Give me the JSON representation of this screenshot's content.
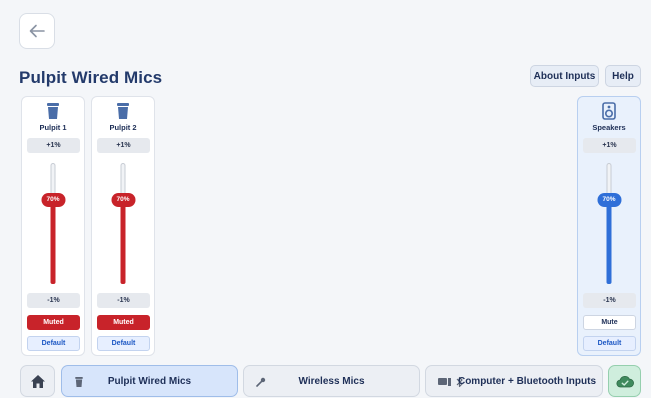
{
  "header": {
    "title": "Pulpit Wired Mics",
    "about_label": "About Inputs",
    "help_label": "Help"
  },
  "channels": [
    {
      "name": "Pulpit 1",
      "icon": "pulpit-icon",
      "increment_label": "+1%",
      "decrement_label": "-1%",
      "level": 70,
      "level_label": "70%",
      "mute_label": "Muted",
      "muted": true,
      "default_label": "Default"
    },
    {
      "name": "Pulpit 2",
      "icon": "pulpit-icon",
      "increment_label": "+1%",
      "decrement_label": "-1%",
      "level": 70,
      "level_label": "70%",
      "mute_label": "Muted",
      "muted": true,
      "default_label": "Default"
    },
    {
      "name": "Speakers",
      "icon": "speaker-icon",
      "increment_label": "+1%",
      "decrement_label": "-1%",
      "level": 70,
      "level_label": "70%",
      "mute_label": "Mute",
      "muted": false,
      "default_label": "Default"
    }
  ],
  "bottom_nav": {
    "home_icon": "home-icon",
    "tabs": [
      {
        "label": "Pulpit Wired Mics",
        "icon": "pulpit-icon",
        "active": true
      },
      {
        "label": "Wireless Mics",
        "icon": "microphone-icon",
        "active": false
      },
      {
        "label": "Computer + Bluetooth Inputs",
        "icon": "computer-bluetooth-icon",
        "active": false
      }
    ],
    "cloud_icon": "cloud-check-icon"
  },
  "colors": {
    "muted_red": "#c8232a",
    "active_blue": "#2f6fd8",
    "title_navy": "#233a6b"
  }
}
